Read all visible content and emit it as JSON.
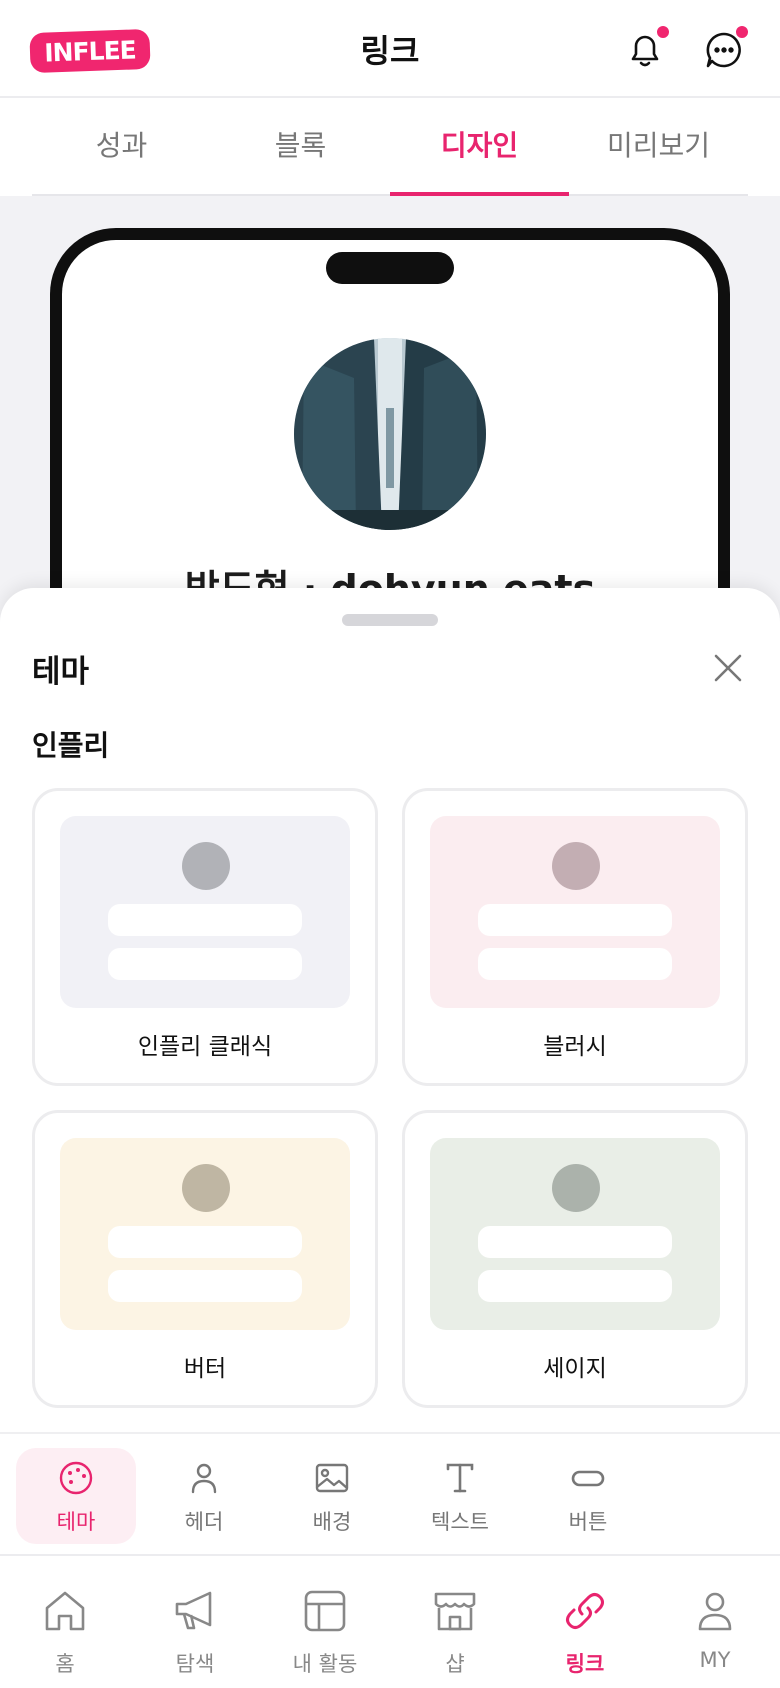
{
  "header": {
    "logo_text": "INFLEE",
    "title": "링크"
  },
  "tabs": [
    {
      "label": "성과"
    },
    {
      "label": "블록"
    },
    {
      "label": "디자인",
      "active": true
    },
    {
      "label": "미리보기"
    }
  ],
  "preview": {
    "profile_name": "박도현 · dohyun eats"
  },
  "sheet": {
    "title": "테마",
    "section_title": "인플리",
    "themes": [
      {
        "name": "인플리 클래식",
        "bg": "#f1f1f6",
        "dot": "#b1b2b7"
      },
      {
        "name": "블러시",
        "bg": "#fbedf0",
        "dot": "#c3aeb3"
      },
      {
        "name": "버터",
        "bg": "#fcf4e4",
        "dot": "#bfb6a3"
      },
      {
        "name": "세이지",
        "bg": "#e9eee7",
        "dot": "#abb2ab"
      }
    ]
  },
  "toolbar": {
    "items": [
      {
        "label": "테마",
        "icon": "palette-icon",
        "active": true
      },
      {
        "label": "헤더",
        "icon": "person-icon"
      },
      {
        "label": "배경",
        "icon": "image-icon"
      },
      {
        "label": "텍스트",
        "icon": "text-icon"
      },
      {
        "label": "버튼",
        "icon": "button-shape-icon"
      }
    ]
  },
  "bottom_nav": {
    "items": [
      {
        "label": "홈",
        "icon": "home-icon"
      },
      {
        "label": "탐색",
        "icon": "megaphone-icon"
      },
      {
        "label": "내 활동",
        "icon": "layout-icon"
      },
      {
        "label": "샵",
        "icon": "shop-icon"
      },
      {
        "label": "링크",
        "icon": "link-icon",
        "active": true
      },
      {
        "label": "MY",
        "icon": "user-icon"
      }
    ]
  },
  "colors": {
    "accent": "#e8246e",
    "logo": "#f0266f",
    "inactive": "#777777"
  }
}
